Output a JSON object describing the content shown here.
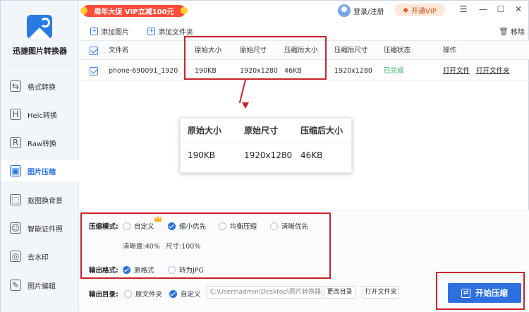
{
  "app": {
    "name": "迅捷图片转换器"
  },
  "sidebar": {
    "items": [
      {
        "label": "格式转换",
        "icon": "format-convert-icon",
        "glyph": "⇆"
      },
      {
        "label": "Heic转换",
        "icon": "heic-icon",
        "glyph": "H"
      },
      {
        "label": "Raw转换",
        "icon": "raw-icon",
        "glyph": "R"
      },
      {
        "label": "图片压缩",
        "icon": "compress-icon",
        "glyph": "▣",
        "active": true
      },
      {
        "label": "抠图换背景",
        "icon": "cutout-icon",
        "glyph": "⬚"
      },
      {
        "label": "智能证件照",
        "icon": "id-photo-icon",
        "glyph": "☺"
      },
      {
        "label": "去水印",
        "icon": "watermark-icon",
        "glyph": "◎"
      },
      {
        "label": "图片编辑",
        "icon": "edit-icon",
        "glyph": "✎"
      }
    ]
  },
  "topbar": {
    "promo": "周年大促 VIP立减100元",
    "login": "登录/注册",
    "vip": "开通VIP",
    "controls": {
      "menu": "☰",
      "minimize": "—",
      "maximize": "☐",
      "close": "✕"
    }
  },
  "toolbar": {
    "add_image": "添加图片",
    "add_folder": "添加文件夹",
    "remove": "移除"
  },
  "table": {
    "headers": [
      "文件名",
      "原始大小",
      "原始尺寸",
      "压缩后大小",
      "压缩后尺寸",
      "压缩状态",
      "操作"
    ],
    "rows": [
      {
        "name": "phone-690091_1920",
        "orig_size": "190KB",
        "orig_dim": "1920x1280",
        "comp_size": "46KB",
        "comp_dim": "1920x1280",
        "status": "已完成",
        "action_open": "打开文件",
        "action_folder": "打开文件夹"
      }
    ]
  },
  "zoom_panel": {
    "headers": [
      "原始大小",
      "原始尺寸",
      "压缩后大小"
    ],
    "values": [
      "190KB",
      "1920x1280",
      "46KB"
    ]
  },
  "settings": {
    "mode_label": "压缩模式:",
    "modes": [
      "自定义",
      "缩小优先",
      "均衡压缩",
      "清晰优先"
    ],
    "selected_mode": "缩小优先",
    "clarity": "清晰度:40%",
    "size": "尺寸:100%",
    "format_label": "输出格式:",
    "formats": [
      "原格式",
      "转为JPG"
    ],
    "selected_format": "原格式",
    "dir_label": "输出目录:",
    "dir_options": [
      "原文件夹",
      "自定义"
    ],
    "selected_dir": "自定义",
    "dir_path": "C:\\Users\\admin\\Desktop\\图片转换器",
    "change_dir": "更改目录",
    "open_folder": "打开文件夹",
    "start": "开始压缩"
  },
  "colors": {
    "accent": "#2d6fe1",
    "highlight": "#c8232c",
    "done": "#2cad5a",
    "promo": "#ff4d3a"
  }
}
